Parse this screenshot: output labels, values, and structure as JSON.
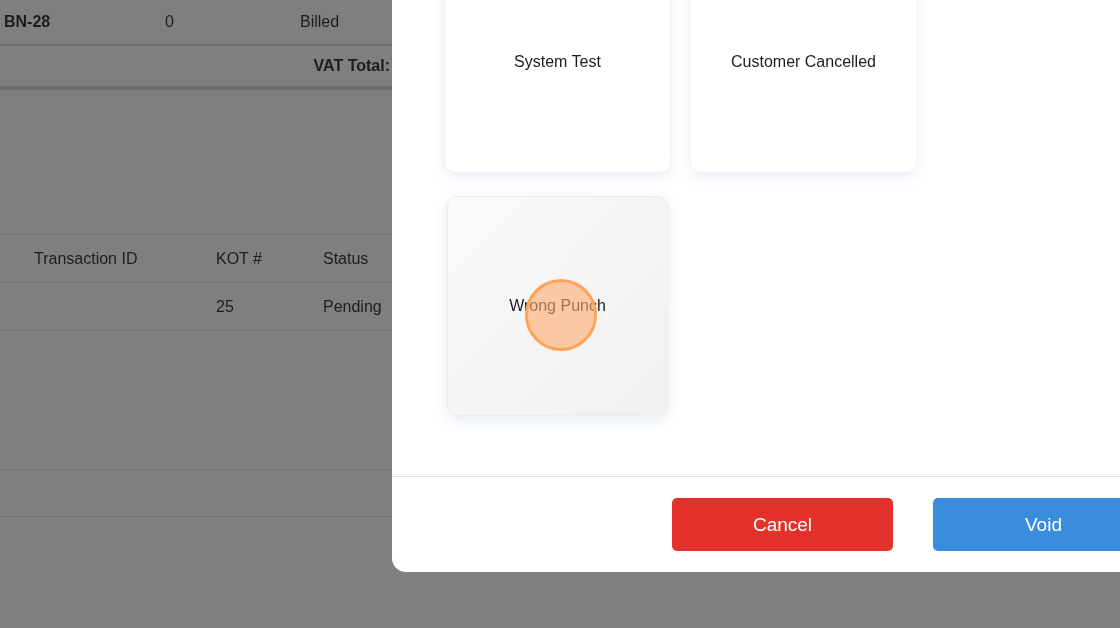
{
  "background_table": {
    "summary_row": {
      "bill_no": "BN-28",
      "count": "0",
      "status": "Billed"
    },
    "vat_total_label": "VAT Total:",
    "columns": [
      "Transaction ID",
      "KOT #",
      "Status"
    ],
    "rows": [
      {
        "kot": "25",
        "status": "Pending"
      }
    ]
  },
  "void_dialog": {
    "reasons": [
      {
        "label": "System Test",
        "selected": false
      },
      {
        "label": "Customer Cancelled",
        "selected": false
      },
      {
        "label": "Wrong Punch",
        "selected": true
      }
    ],
    "buttons": [
      {
        "label": "Cancel",
        "kind": "danger"
      },
      {
        "label": "Void",
        "kind": "primary"
      }
    ]
  }
}
